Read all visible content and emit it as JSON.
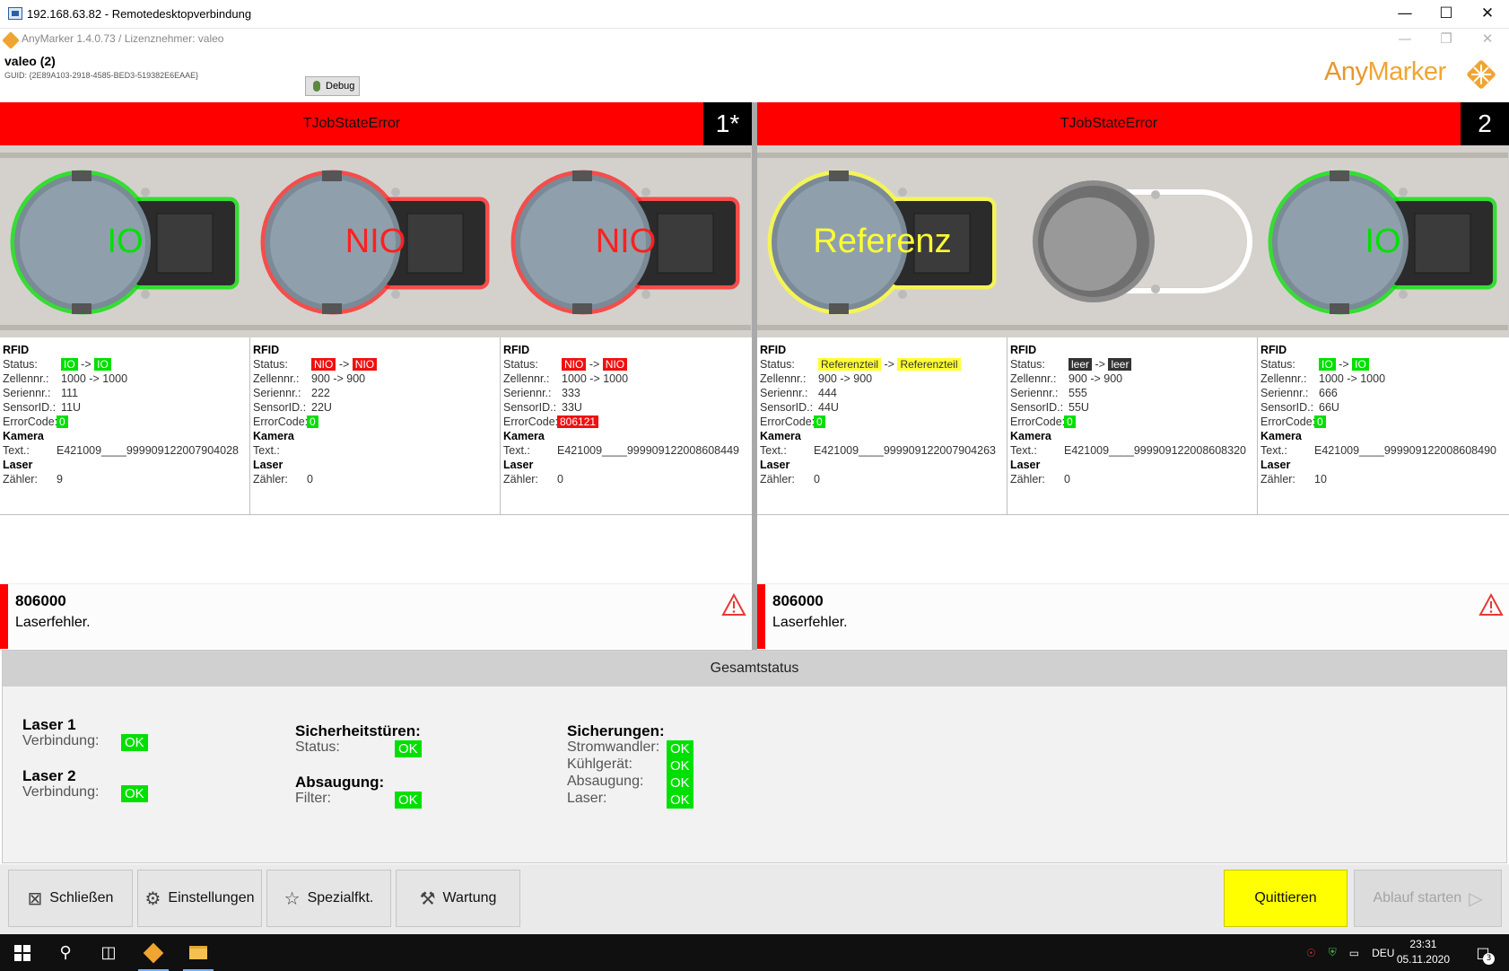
{
  "rdp": {
    "title": "192.168.63.82 - Remotedesktopverbindung"
  },
  "app": {
    "title": "AnyMarker 1.4.0.73 / Lizenznehmer: valeo",
    "brand_a": "Any",
    "brand_b": "Marker"
  },
  "project": {
    "name": "valeo (2)",
    "guid": "GUID: {2E89A103-2918-4585-BED3-519382E6EAAE}",
    "debug_label": "Debug"
  },
  "stations": [
    {
      "state": "TJobStateError",
      "number": "1*",
      "cells": [
        {
          "overlay": "IO",
          "status_color": "#00e000",
          "rows": {
            "rfid": "RFID",
            "status_label": "Status:",
            "status_from": "IO",
            "arrow": "->",
            "status_to": "IO",
            "zellen_label": "Zellennr.:",
            "zellen": "1000 -> 1000",
            "serien_label": "Seriennr.:",
            "serien": "111",
            "sensor_label": "SensorID.:",
            "sensor": "11U",
            "error_label": "ErrorCode:",
            "error": "0",
            "kamera": "Kamera",
            "text_label": "Text.:",
            "text": "E421009____999909122007904028",
            "laser": "Laser",
            "zaehler_label": "Zähler:",
            "zaehler": "9"
          }
        },
        {
          "overlay": "NIO",
          "status_color": "#ff2020",
          "rows": {
            "rfid": "RFID",
            "status_label": "Status:",
            "status_from": "NIO",
            "arrow": "->",
            "status_to": "NIO",
            "zellen_label": "Zellennr.:",
            "zellen": "900 -> 900",
            "serien_label": "Seriennr.:",
            "serien": "222",
            "sensor_label": "SensorID.:",
            "sensor": "22U",
            "error_label": "ErrorCode:",
            "error": "0",
            "kamera": "Kamera",
            "text_label": "Text.:",
            "text": "",
            "laser": "Laser",
            "zaehler_label": "Zähler:",
            "zaehler": "0"
          }
        },
        {
          "overlay": "NIO",
          "status_color": "#ff2020",
          "rows": {
            "rfid": "RFID",
            "status_label": "Status:",
            "status_from": "NIO",
            "arrow": "->",
            "status_to": "NIO",
            "zellen_label": "Zellennr.:",
            "zellen": "1000 -> 1000",
            "serien_label": "Seriennr.:",
            "serien": "333",
            "sensor_label": "SensorID.:",
            "sensor": "33U",
            "error_label": "ErrorCode:",
            "error": "806121",
            "kamera": "Kamera",
            "text_label": "Text.:",
            "text": "E421009____999909122008608449",
            "laser": "Laser",
            "zaehler_label": "Zähler:",
            "zaehler": "0"
          }
        }
      ],
      "error": {
        "code": "806000",
        "message": "Laserfehler."
      }
    },
    {
      "state": "TJobStateError",
      "number": "2",
      "cells": [
        {
          "overlay": "Referenz",
          "status_color": "#ffff33",
          "rows": {
            "rfid": "RFID",
            "status_label": "Status:",
            "status_from": "Referenzteil",
            "arrow": "->",
            "status_to": "Referenzteil",
            "zellen_label": "Zellennr.:",
            "zellen": "900 -> 900",
            "serien_label": "Seriennr.:",
            "serien": "444",
            "sensor_label": "SensorID.:",
            "sensor": "44U",
            "error_label": "ErrorCode:",
            "error": "0",
            "kamera": "Kamera",
            "text_label": "Text.:",
            "text": "E421009____999909122007904263",
            "laser": "Laser",
            "zaehler_label": "Zähler:",
            "zaehler": "0"
          }
        },
        {
          "overlay": "",
          "status_color": "",
          "rows": {
            "rfid": "RFID",
            "status_label": "Status:",
            "status_from": "leer",
            "arrow": "->",
            "status_to": "leer",
            "zellen_label": "Zellennr.:",
            "zellen": "900 -> 900",
            "serien_label": "Seriennr.:",
            "serien": "555",
            "sensor_label": "SensorID.:",
            "sensor": "55U",
            "error_label": "ErrorCode:",
            "error": "0",
            "kamera": "Kamera",
            "text_label": "Text.:",
            "text": "E421009____999909122008608320",
            "laser": "Laser",
            "zaehler_label": "Zähler:",
            "zaehler": "0"
          }
        },
        {
          "overlay": "IO",
          "status_color": "#00e000",
          "rows": {
            "rfid": "RFID",
            "status_label": "Status:",
            "status_from": "IO",
            "arrow": "->",
            "status_to": "IO",
            "zellen_label": "Zellennr.:",
            "zellen": "1000 -> 1000",
            "serien_label": "Seriennr.:",
            "serien": "666",
            "sensor_label": "SensorID.:",
            "sensor": "66U",
            "error_label": "ErrorCode:",
            "error": "0",
            "kamera": "Kamera",
            "text_label": "Text.:",
            "text": "E421009____999909122008608490",
            "laser": "Laser",
            "zaehler_label": "Zähler:",
            "zaehler": "10"
          }
        }
      ],
      "error": {
        "code": "806000",
        "message": "Laserfehler."
      }
    }
  ],
  "gesamtstatus": {
    "title": "Gesamtstatus",
    "laser1": {
      "head": "Laser 1",
      "label": "Verbindung:",
      "value": "OK"
    },
    "laser2": {
      "head": "Laser 2",
      "label": "Verbindung:",
      "value": "OK"
    },
    "doors": {
      "head": "Sicherheitstüren:",
      "label": "Status:",
      "value": "OK"
    },
    "suction": {
      "head": "Absaugung:",
      "label": "Filter:",
      "value": "OK"
    },
    "fuses": {
      "head": "Sicherungen:",
      "items": [
        {
          "label": "Stromwandler:",
          "value": "OK"
        },
        {
          "label": "Kühlgerät:",
          "value": "OK"
        },
        {
          "label": "Absaugung:",
          "value": "OK"
        },
        {
          "label": "Laser:",
          "value": "OK"
        }
      ]
    }
  },
  "buttons": {
    "close": "Schließen",
    "settings": "Einstellungen",
    "special": "Spezialfkt.",
    "maintenance": "Wartung",
    "acknowledge": "Quittieren",
    "start": "Ablauf starten"
  },
  "taskbar": {
    "lang": "DEU",
    "time": "23:31",
    "date": "05.11.2020",
    "notifications": "3"
  },
  "colors": {
    "error_red": "#ff0000",
    "ok_green": "#00e000",
    "quit_yellow": "#ffff00"
  }
}
